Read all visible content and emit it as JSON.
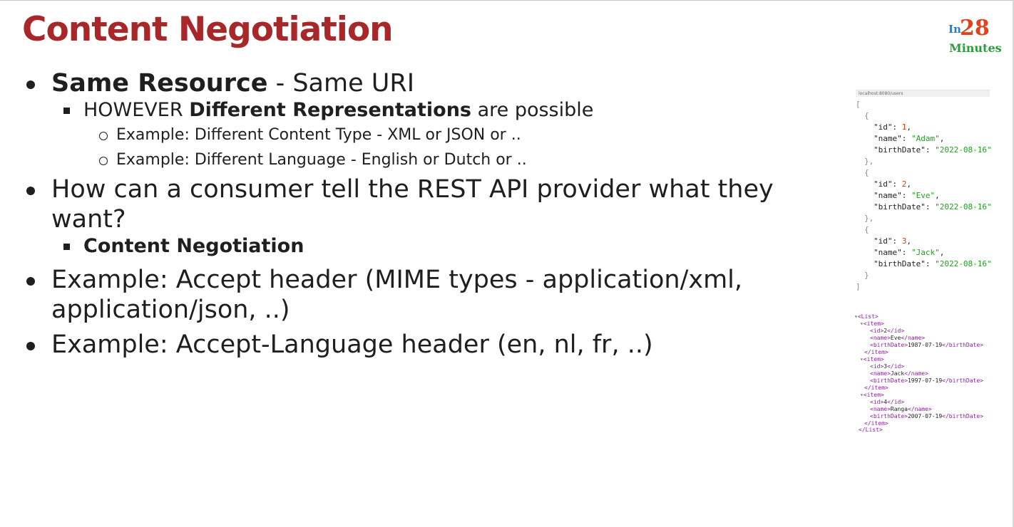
{
  "slide": {
    "title": "Content Negotiation"
  },
  "logo": {
    "in": "In",
    "number": "28",
    "minutes": "Minutes"
  },
  "bullets": {
    "b1": {
      "bold": "Same Resource",
      "rest": " - Same URI"
    },
    "b1_sub": {
      "prefix": "HOWEVER ",
      "bold": "Different Representations",
      "suffix": " are possible"
    },
    "b1_sub_ex1": "Example: Different Content Type - XML or JSON or ..",
    "b1_sub_ex2": "Example: Different Language - English or Dutch or ..",
    "b2_line1": "How can a consumer tell the REST API provider what they",
    "b2_line2": "want?",
    "b2_sub": "Content Negotiation",
    "b3_line1": "Example: Accept header (MIME types - application/xml,",
    "b3_line2": "application/json, ..)",
    "b4": "Example: Accept-Language header (en, nl, fr, ..)"
  },
  "json_preview": {
    "url": "localhost:8080/users",
    "open_bracket": "[",
    "close_bracket": "]",
    "key_id": "\"id\"",
    "key_name": "\"name\"",
    "key_birth": "\"birthDate\"",
    "users": [
      {
        "id": "1",
        "name": "\"Adam\"",
        "birthDate": "\"2022-08-16\""
      },
      {
        "id": "2",
        "name": "\"Eve\"",
        "birthDate": "\"2022-08-16\""
      },
      {
        "id": "3",
        "name": "\"Jack\"",
        "birthDate": "\"2022-08-16\""
      }
    ]
  },
  "xml_preview": {
    "list_open": "<List>",
    "list_close": "</List>",
    "item_open": "<item>",
    "item_close": "</item>",
    "items": [
      {
        "id": "2",
        "name": "Eve",
        "birthDate": "1987-07-19"
      },
      {
        "id": "3",
        "name": "Jack",
        "birthDate": "1997-07-19"
      },
      {
        "id": "4",
        "name": "Ranga",
        "birthDate": "2007-07-19"
      }
    ]
  },
  "colors": {
    "title": "#a8282a",
    "json_string": "#22a022",
    "json_number": "#d04000",
    "xml_tag": "#8a1f9a"
  }
}
